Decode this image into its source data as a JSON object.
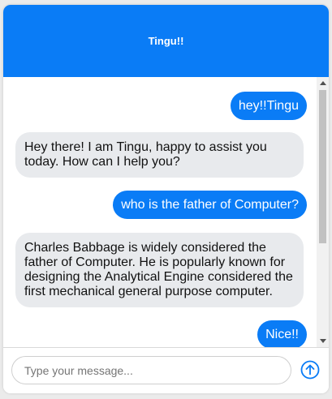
{
  "header": {
    "title": "Tingu!!"
  },
  "messages": [
    {
      "sender": "user",
      "text": "hey!!Tingu"
    },
    {
      "sender": "bot",
      "text": "Hey there! I am Tingu, happy to assist you today. How can I help you?"
    },
    {
      "sender": "user",
      "text": "who is the father of Computer?"
    },
    {
      "sender": "bot",
      "text": "Charles Babbage is widely considered the father of Computer. He is popularly known for designing the Analytical Engine considered the first mechanical general purpose computer."
    },
    {
      "sender": "user",
      "text": "Nice!!"
    }
  ],
  "composer": {
    "placeholder": "Type your message...",
    "value": ""
  },
  "icons": {
    "send": "arrow-up-circle-icon"
  },
  "colors": {
    "accent": "#0a7cf6",
    "bot_bubble": "#e8eaed"
  }
}
